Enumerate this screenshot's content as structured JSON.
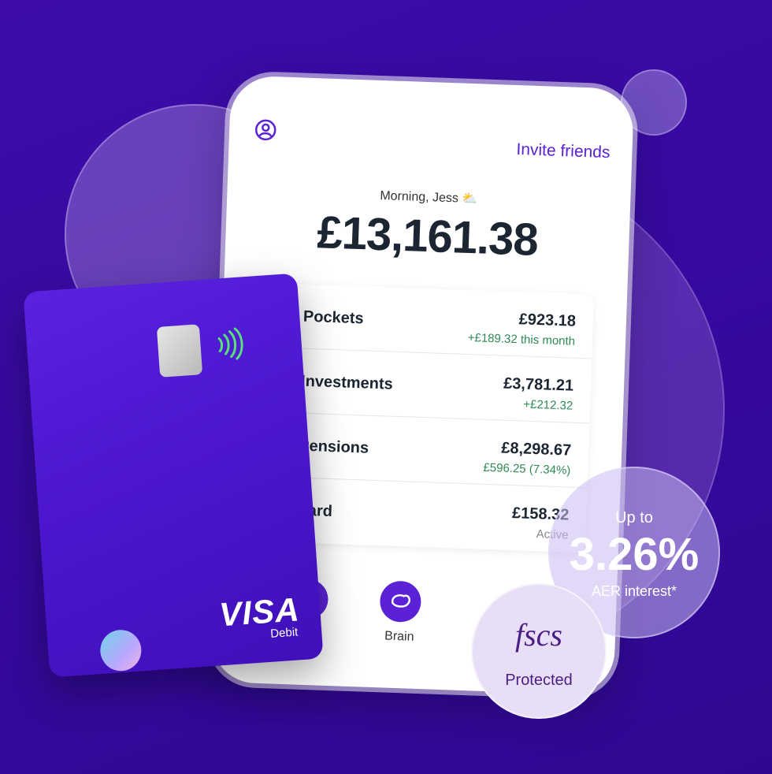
{
  "header": {
    "invite_label": "Invite friends",
    "profile_icon": "profile-icon"
  },
  "greeting": "Morning, Jess ⛅",
  "balance": "£13,161.38",
  "accounts": [
    {
      "name": "Pockets",
      "amount": "£923.18",
      "sub": "+£189.32 this month"
    },
    {
      "name": "Investments",
      "amount": "£3,781.21",
      "sub": "+£212.32"
    },
    {
      "name": "Pensions",
      "amount": "£8,298.67",
      "sub": "£596.25 (7.34%)"
    },
    {
      "name": "Card",
      "amount": "£158.32",
      "sub": "Active"
    }
  ],
  "nav": {
    "brain_label": "Brain",
    "brain_icon": "brain-icon"
  },
  "card": {
    "brand": "VISA",
    "type": "Debit",
    "logo_icon": "app-logo-icon"
  },
  "rate": {
    "upto": "Up to",
    "value": "3.26%",
    "sub": "AER interest*"
  },
  "fscs": {
    "logo": "fscs",
    "label": "Protected"
  },
  "colors": {
    "background": "#3a0ca3",
    "accent": "#5b21d6",
    "positive": "#2f8a57"
  }
}
